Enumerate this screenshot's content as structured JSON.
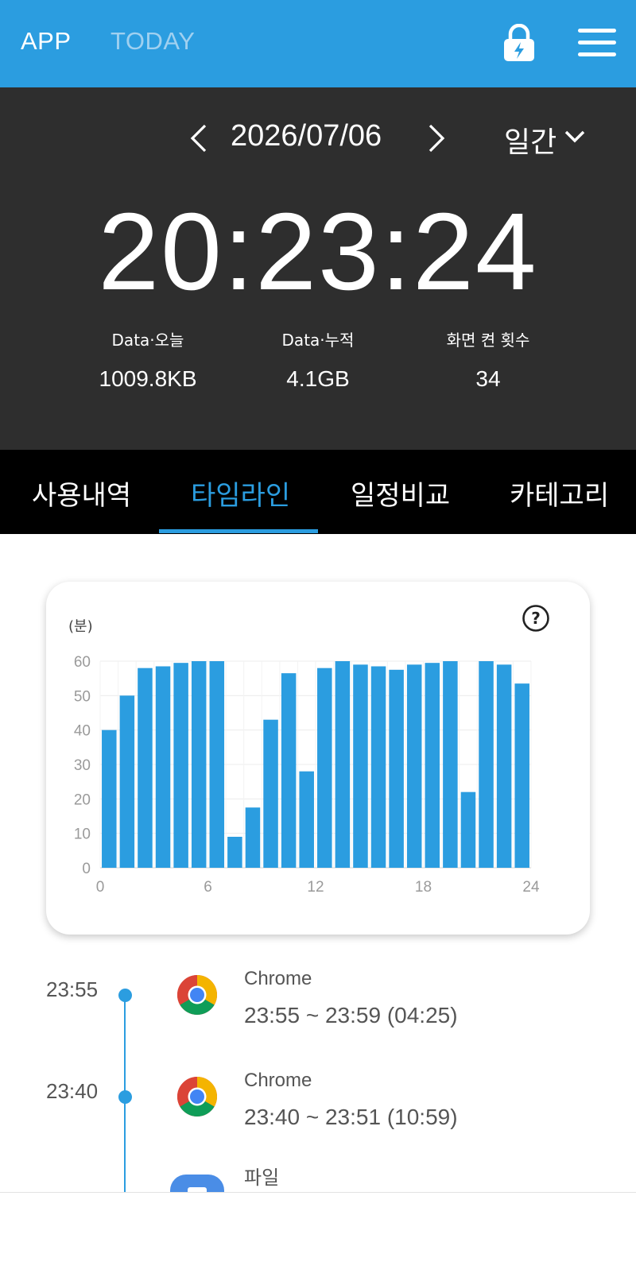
{
  "header": {
    "tab_app": "APP",
    "tab_today": "TODAY",
    "lock_icon": "lock-bolt-icon",
    "menu_icon": "hamburger-menu-icon",
    "accent_color": "#2b9de0"
  },
  "summary": {
    "date": "2026/07/06",
    "period": "일간",
    "total_time": "20:23:24",
    "stats": [
      {
        "label": "Data·오늘",
        "value": "1009.8KB"
      },
      {
        "label": "Data·누적",
        "value": "4.1GB"
      },
      {
        "label": "화면 켠 횟수",
        "value": "34"
      }
    ]
  },
  "tabs": [
    "사용내역",
    "타임라인",
    "일정비교",
    "카테고리"
  ],
  "active_tab": "타임라인",
  "chart_data": {
    "type": "bar",
    "title": "",
    "ylabel": "(분)",
    "xlabel": "",
    "x_ticks": [
      "0",
      "6",
      "12",
      "18",
      "24"
    ],
    "y_ticks": [
      "0",
      "10",
      "20",
      "30",
      "40",
      "50",
      "60"
    ],
    "ylim": [
      0,
      60
    ],
    "xlim": [
      0,
      24
    ],
    "categories": [
      0,
      1,
      2,
      3,
      4,
      5,
      6,
      7,
      8,
      9,
      10,
      11,
      12,
      13,
      14,
      15,
      16,
      17,
      18,
      19,
      20,
      21,
      22,
      23
    ],
    "values": [
      40,
      50,
      58,
      58.5,
      59.5,
      60,
      60,
      9,
      17.5,
      43,
      56.5,
      28,
      58,
      60,
      59,
      58.5,
      57.5,
      59,
      59.5,
      60,
      22,
      60,
      59,
      53.5
    ],
    "bar_color": "#2b9de0",
    "grid": true
  },
  "timeline": [
    {
      "time": "23:55",
      "app": "Chrome",
      "range": "23:55 ~ 23:59 (04:25)",
      "icon": "chrome-icon"
    },
    {
      "time": "23:40",
      "app": "Chrome",
      "range": "23:40 ~ 23:51 (10:59)",
      "icon": "chrome-icon"
    },
    {
      "time": "",
      "app": "파일",
      "range": "",
      "icon": "files-app-icon"
    }
  ]
}
